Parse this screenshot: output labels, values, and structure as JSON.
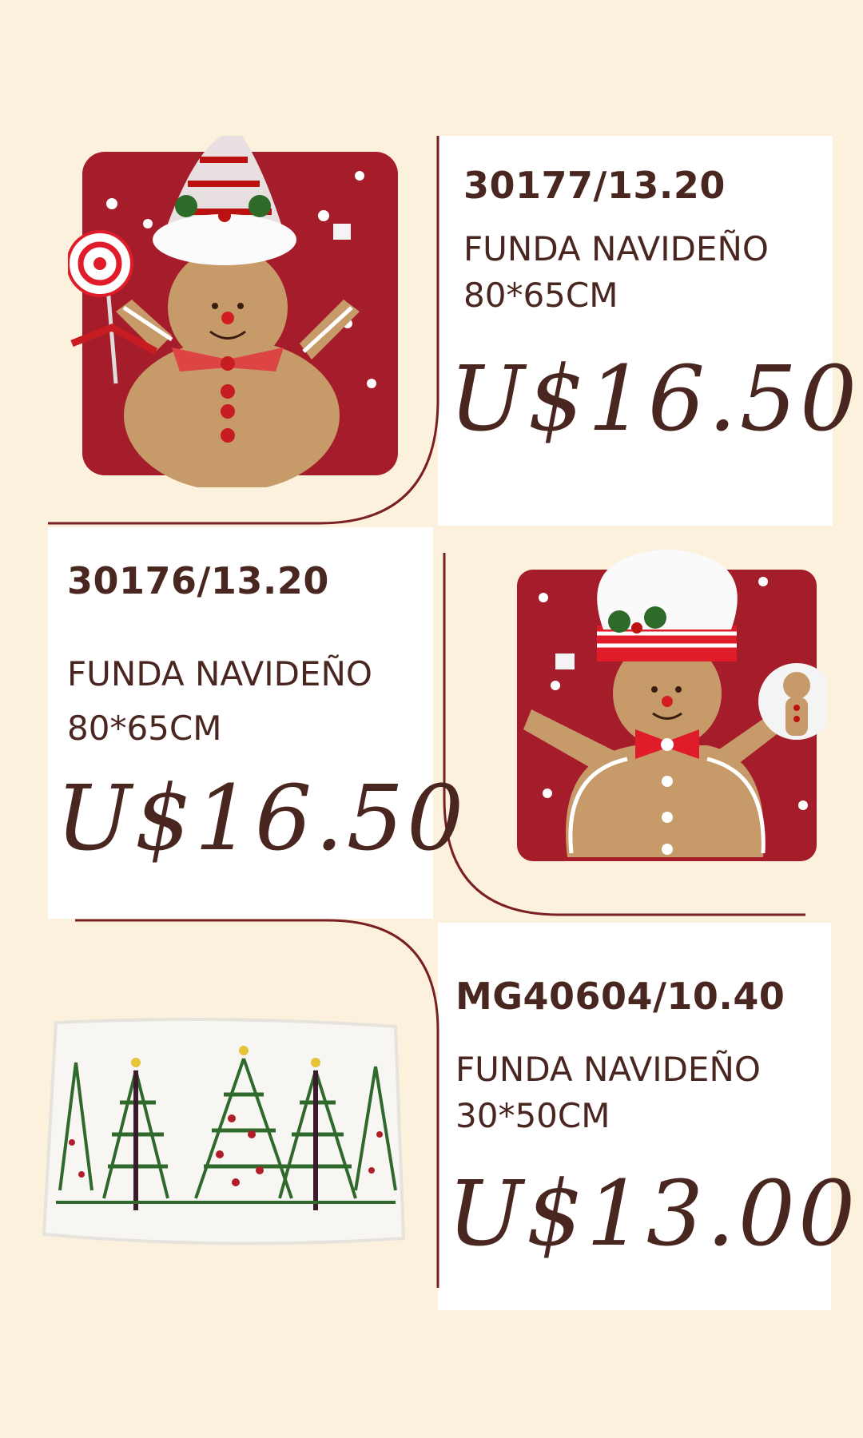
{
  "products": [
    {
      "code": "30177/13.20",
      "desc_line1": "FUNDA NAVIDEÑO",
      "desc_line2": "80*65CM",
      "price": "U$16.50",
      "image": "gingerbread-santa-hat-pillow"
    },
    {
      "code": "30176/13.20",
      "desc_line1": "FUNDA NAVIDEÑO",
      "desc_line2": "80*65CM",
      "price": "U$16.50",
      "image": "gingerbread-chef-hat-pillow"
    },
    {
      "code": "MG40604/10.40",
      "desc_line1": "FUNDA NAVIDEÑO",
      "desc_line2": "30*50CM",
      "price": "U$13.00",
      "image": "christmas-trees-pillow"
    }
  ],
  "colors": {
    "background": "#fcf1dd",
    "panel": "#ffffff",
    "text": "#4a2620",
    "accent_line": "#7a1f22",
    "pillow_red": "#a51c2a",
    "gingerbread": "#c79a6a"
  }
}
